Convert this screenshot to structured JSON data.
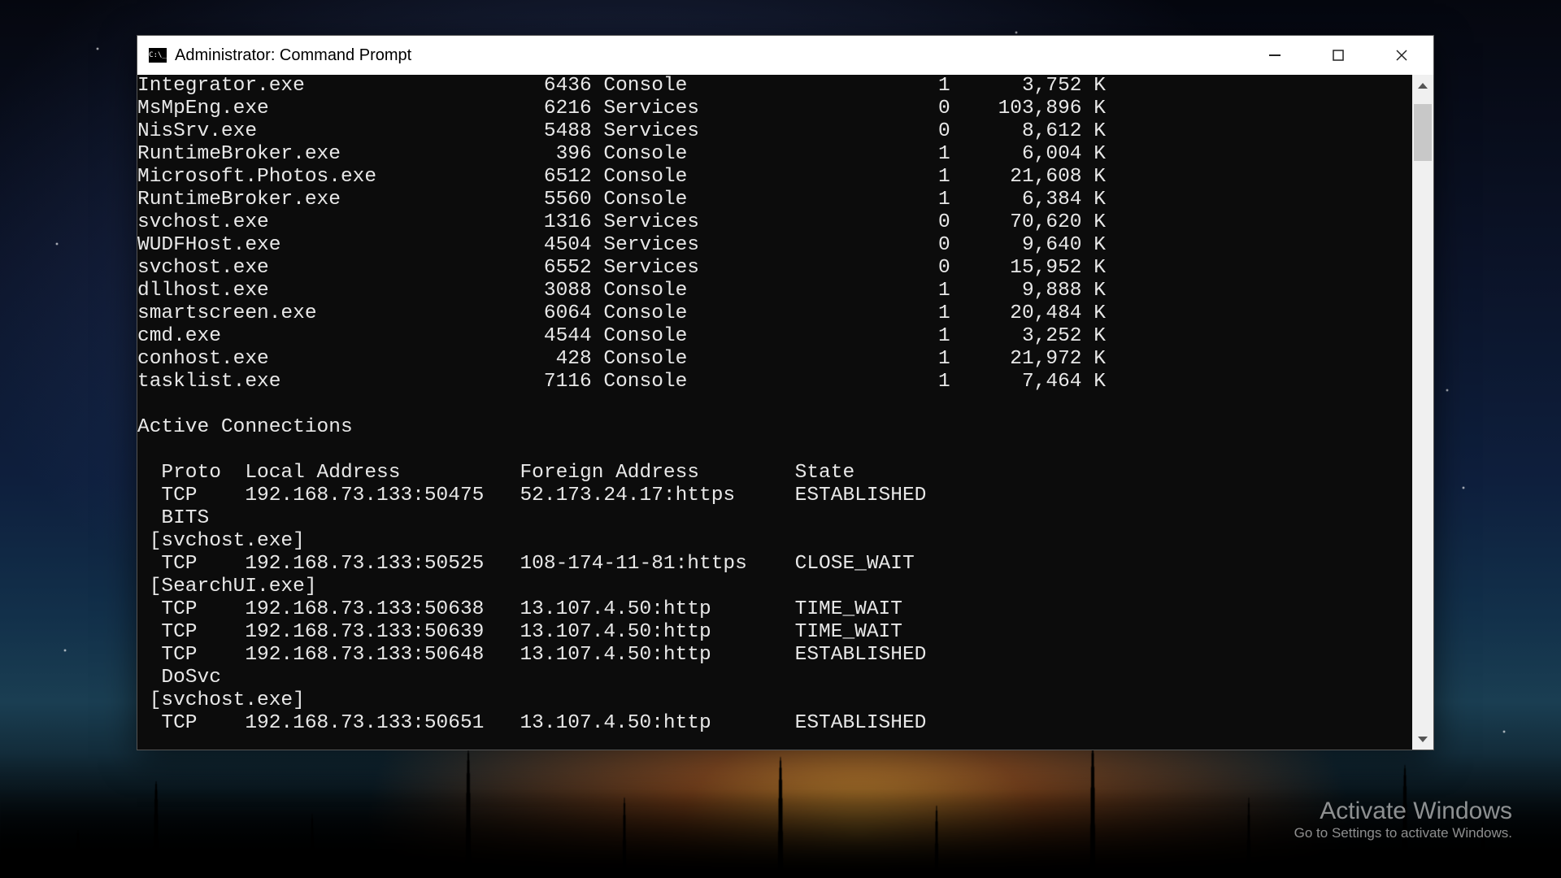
{
  "watermark": {
    "line1": "Activate Windows",
    "line2": "Go to Settings to activate Windows."
  },
  "window": {
    "title": "Administrator: Command Prompt"
  },
  "tasklist": {
    "cols": {
      "name_w": 30,
      "pid_w": 8,
      "sess_name_w": 17,
      "sess_num_w": 12,
      "mem_w": 13
    },
    "rows": [
      {
        "name": "Integrator.exe",
        "pid": "6436",
        "sess_name": "Console",
        "sess_num": "1",
        "mem": "3,752 K"
      },
      {
        "name": "MsMpEng.exe",
        "pid": "6216",
        "sess_name": "Services",
        "sess_num": "0",
        "mem": "103,896 K"
      },
      {
        "name": "NisSrv.exe",
        "pid": "5488",
        "sess_name": "Services",
        "sess_num": "0",
        "mem": "8,612 K"
      },
      {
        "name": "RuntimeBroker.exe",
        "pid": "396",
        "sess_name": "Console",
        "sess_num": "1",
        "mem": "6,004 K"
      },
      {
        "name": "Microsoft.Photos.exe",
        "pid": "6512",
        "sess_name": "Console",
        "sess_num": "1",
        "mem": "21,608 K"
      },
      {
        "name": "RuntimeBroker.exe",
        "pid": "5560",
        "sess_name": "Console",
        "sess_num": "1",
        "mem": "6,384 K"
      },
      {
        "name": "svchost.exe",
        "pid": "1316",
        "sess_name": "Services",
        "sess_num": "0",
        "mem": "70,620 K"
      },
      {
        "name": "WUDFHost.exe",
        "pid": "4504",
        "sess_name": "Services",
        "sess_num": "0",
        "mem": "9,640 K"
      },
      {
        "name": "svchost.exe",
        "pid": "6552",
        "sess_name": "Services",
        "sess_num": "0",
        "mem": "15,952 K"
      },
      {
        "name": "dllhost.exe",
        "pid": "3088",
        "sess_name": "Console",
        "sess_num": "1",
        "mem": "9,888 K"
      },
      {
        "name": "smartscreen.exe",
        "pid": "6064",
        "sess_name": "Console",
        "sess_num": "1",
        "mem": "20,484 K"
      },
      {
        "name": "cmd.exe",
        "pid": "4544",
        "sess_name": "Console",
        "sess_num": "1",
        "mem": "3,252 K"
      },
      {
        "name": "conhost.exe",
        "pid": "428",
        "sess_name": "Console",
        "sess_num": "1",
        "mem": "21,972 K"
      },
      {
        "name": "tasklist.exe",
        "pid": "7116",
        "sess_name": "Console",
        "sess_num": "1",
        "mem": "7,464 K"
      }
    ]
  },
  "netstat": {
    "heading": "Active Connections",
    "header": {
      "proto": "Proto",
      "local": "Local Address",
      "foreign": "Foreign Address",
      "state": "State"
    },
    "lines": [
      {
        "type": "row",
        "proto": "TCP",
        "local": "192.168.73.133:50475",
        "foreign": "52.173.24.17:https",
        "state": "ESTABLISHED"
      },
      {
        "type": "svc",
        "text": "BITS"
      },
      {
        "type": "owner",
        "text": "[svchost.exe]"
      },
      {
        "type": "row",
        "proto": "TCP",
        "local": "192.168.73.133:50525",
        "foreign": "108-174-11-81:https",
        "state": "CLOSE_WAIT"
      },
      {
        "type": "owner",
        "text": "[SearchUI.exe]"
      },
      {
        "type": "row",
        "proto": "TCP",
        "local": "192.168.73.133:50638",
        "foreign": "13.107.4.50:http",
        "state": "TIME_WAIT"
      },
      {
        "type": "row",
        "proto": "TCP",
        "local": "192.168.73.133:50639",
        "foreign": "13.107.4.50:http",
        "state": "TIME_WAIT"
      },
      {
        "type": "row",
        "proto": "TCP",
        "local": "192.168.73.133:50648",
        "foreign": "13.107.4.50:http",
        "state": "ESTABLISHED"
      },
      {
        "type": "svc",
        "text": "DoSvc"
      },
      {
        "type": "owner",
        "text": "[svchost.exe]"
      },
      {
        "type": "row",
        "proto": "TCP",
        "local": "192.168.73.133:50651",
        "foreign": "13.107.4.50:http",
        "state": "ESTABLISHED"
      }
    ]
  }
}
